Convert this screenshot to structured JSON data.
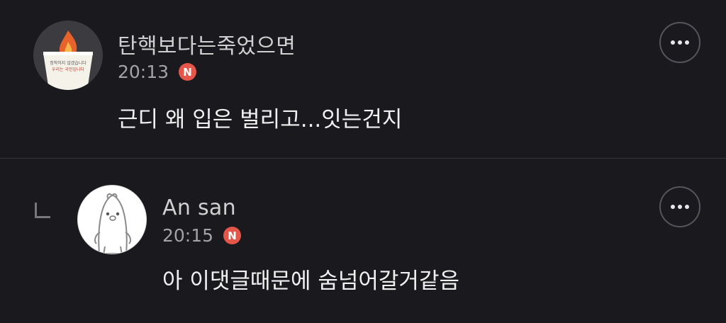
{
  "comments": [
    {
      "author": "탄핵보다는죽었으면",
      "time": "20:13",
      "badge": "N",
      "text": "근디 왜 입은 벌리고...잇는건지",
      "avatar": {
        "line1": "정착하지 않겠습니다",
        "line2": "우리는 국민입니다"
      }
    },
    {
      "author": "An san",
      "time": "20:15",
      "badge": "N",
      "text": "아 이댓글때문에 숨넘어갈거같음"
    }
  ],
  "colors": {
    "background": "#1a1a1e",
    "badge": "#e4564a",
    "divider": "#34343a"
  },
  "icons": [
    "more-options-icon",
    "reply-indent-icon",
    "new-badge-icon"
  ]
}
